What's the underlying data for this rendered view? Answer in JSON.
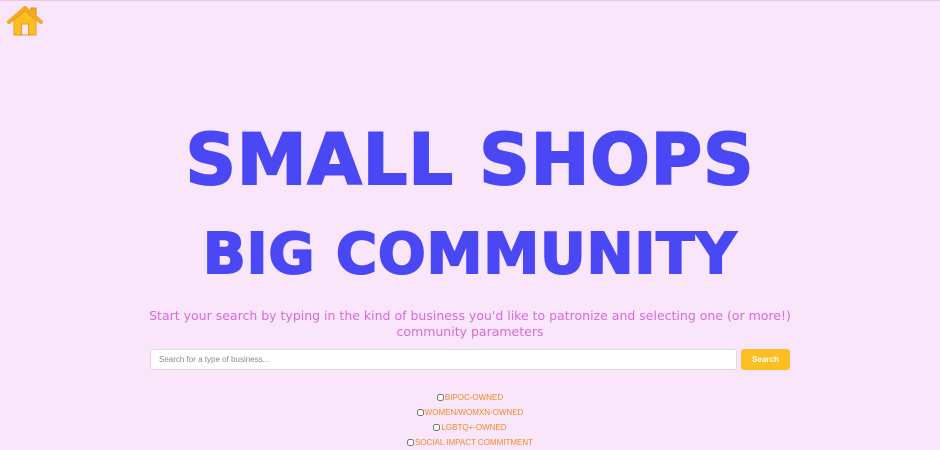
{
  "nav": {
    "home_icon": "home-icon",
    "home_color": "#fbbf24"
  },
  "hero": {
    "line1": "SMALL SHOPS",
    "line2": "BIG COMMUNITY",
    "color": "#4a47f5"
  },
  "subtitle": "Start your search by typing in the kind of business you'd like to patronize and selecting one (or more!) community parameters",
  "search": {
    "placeholder": "Search for a type of business...",
    "value": "",
    "button_label": "Search",
    "button_color": "#fbbf24"
  },
  "filters": [
    {
      "label": "BIPOC-OWNED",
      "checked": false
    },
    {
      "label": "WOMEN/WOMXN-OWNED",
      "checked": false
    },
    {
      "label": "LGBTQ+-OWNED",
      "checked": false
    },
    {
      "label": "SOCIAL IMPACT COMMITMENT",
      "checked": false
    }
  ],
  "colors": {
    "background": "#f9e6fb",
    "subtitle": "#d96ad9",
    "filter_text": "#f08a24"
  }
}
